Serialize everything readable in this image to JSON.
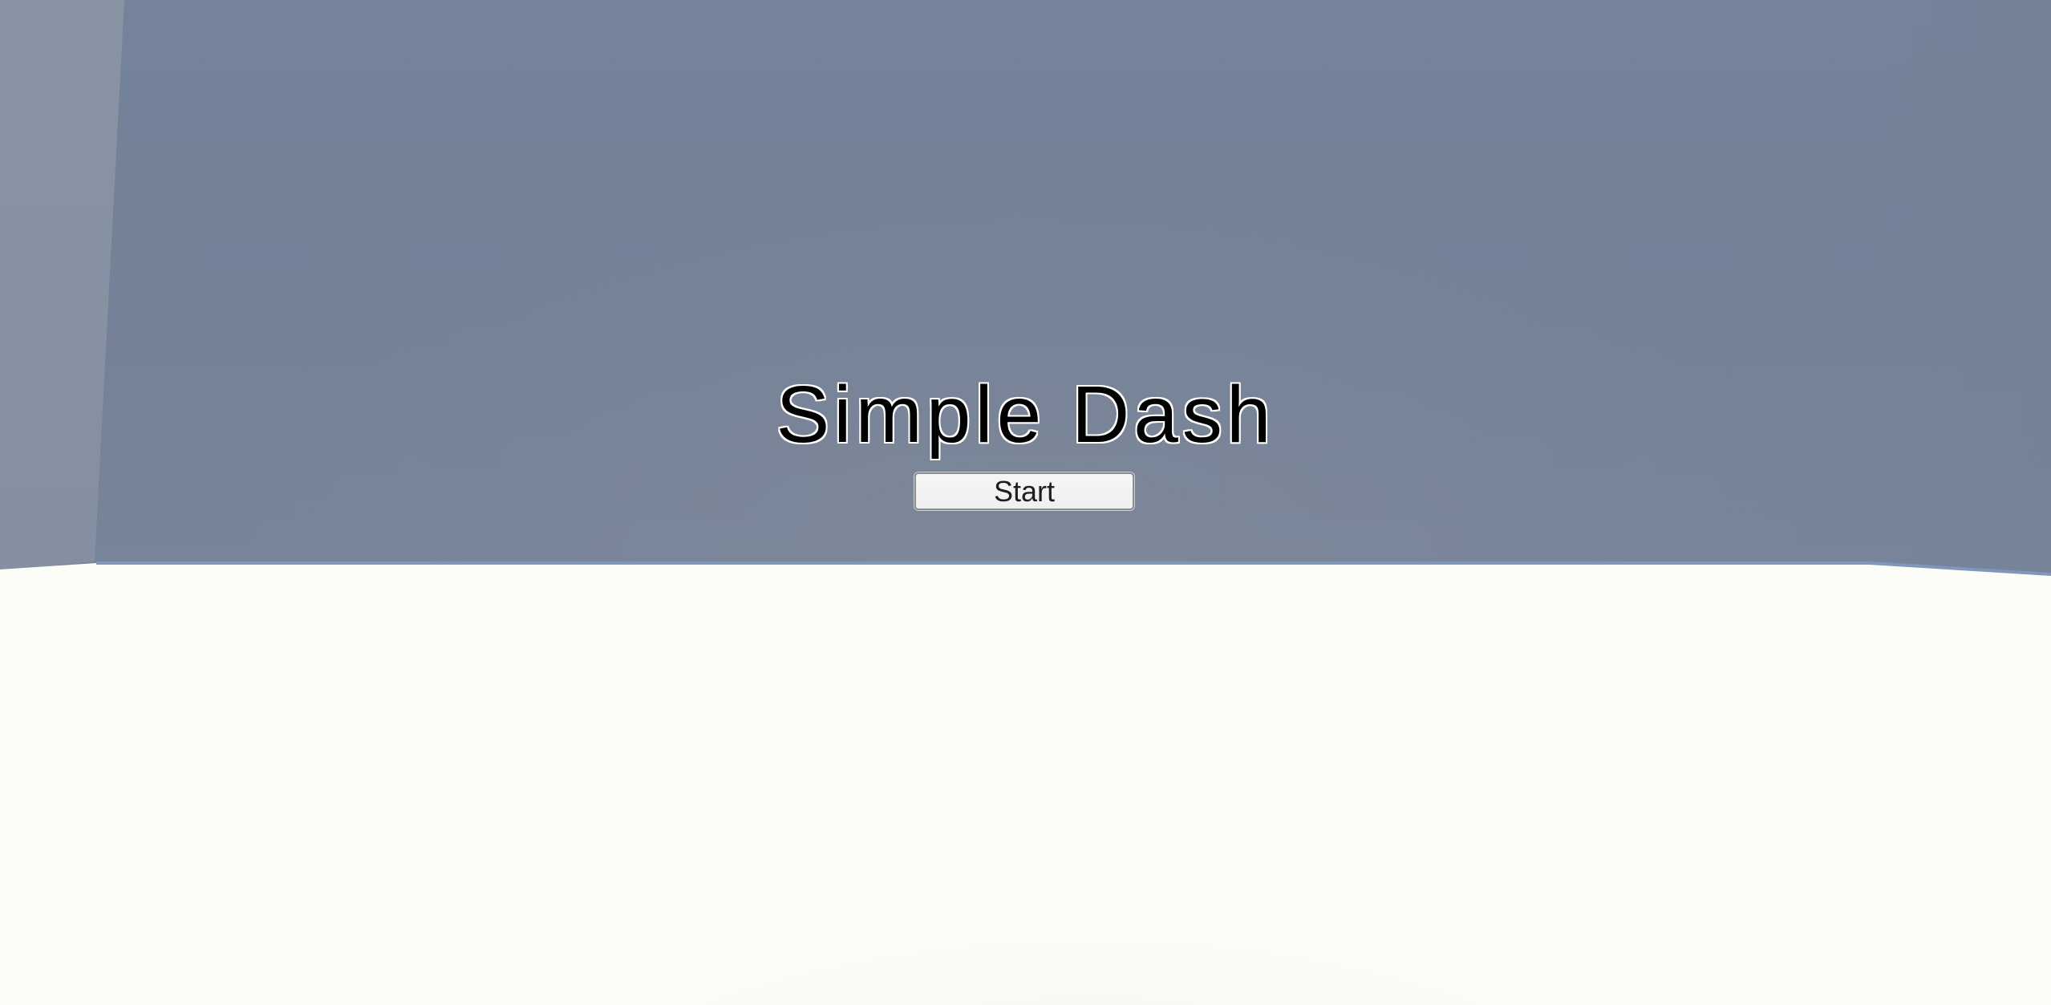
{
  "game": {
    "title": "Simple Dash",
    "start_label": "Start"
  },
  "colors": {
    "wall": "#74839a",
    "side_wall": "#8893a4",
    "floor": "#fdfdf8",
    "floor_edge": "#7f97bd",
    "title_text": "#000000",
    "title_outline": "#ffffff",
    "button_bg": "#f3f3f3",
    "button_border": "#8d8d8d"
  }
}
